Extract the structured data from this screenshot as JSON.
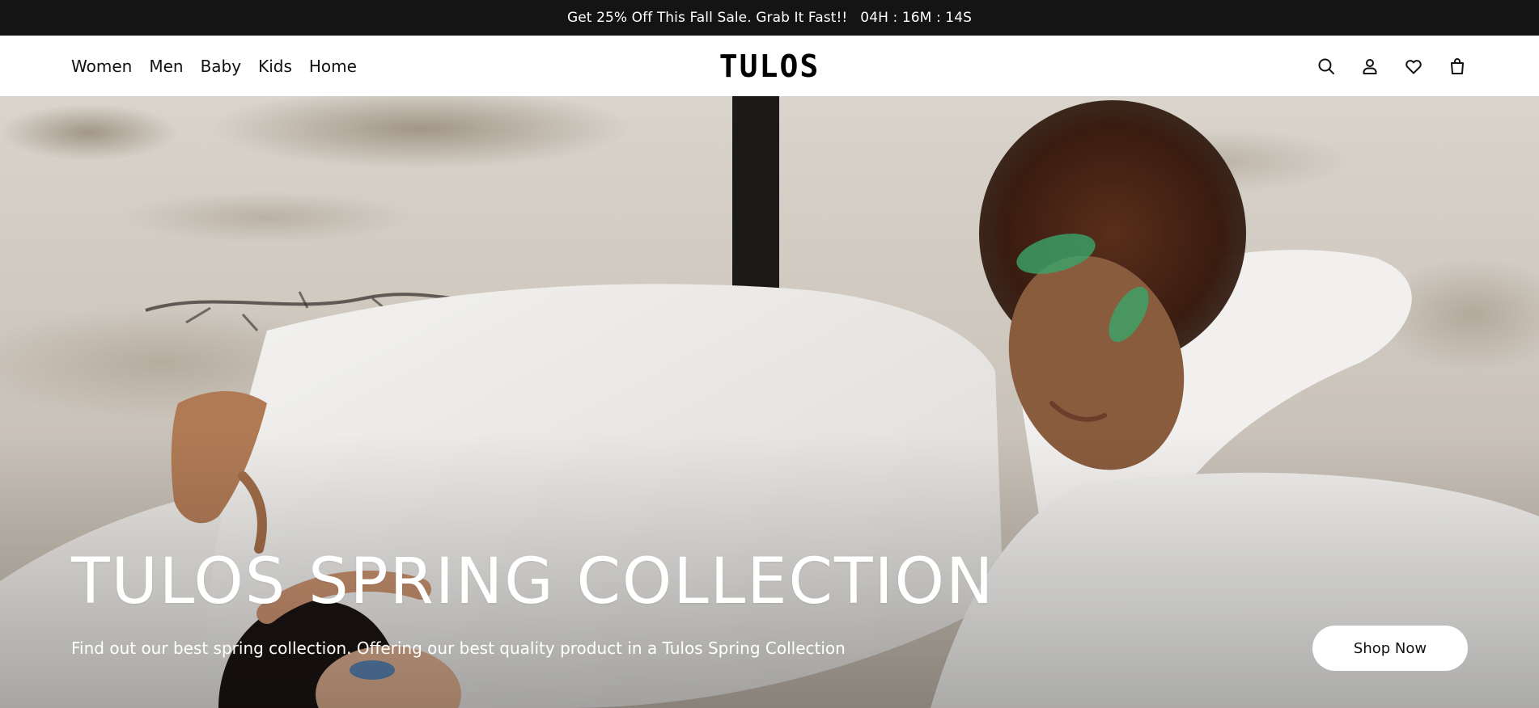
{
  "announcement": {
    "text": "Get 25% Off This Fall Sale. Grab It Fast!!",
    "countdown": "04H : 16M : 14S"
  },
  "header": {
    "nav": [
      {
        "label": "Women"
      },
      {
        "label": "Men"
      },
      {
        "label": "Baby"
      },
      {
        "label": "Kids"
      },
      {
        "label": "Home"
      }
    ],
    "logo": "TULOS",
    "icons": [
      "search-icon",
      "user-icon",
      "heart-icon",
      "shopping-bag-icon"
    ]
  },
  "hero": {
    "title": "TULOS SPRING COLLECTION",
    "subtitle": "Find out our best spring collection. Offering our best quality product in a Tulos Spring Collection",
    "cta_label": "Shop Now"
  }
}
